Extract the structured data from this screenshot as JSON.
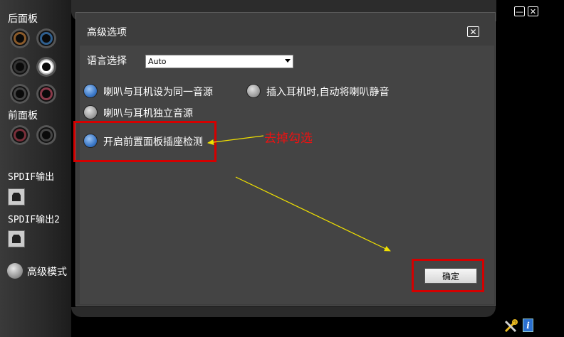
{
  "left_panel": {
    "rear_panel_label": "后面板",
    "front_panel_label": "前面板",
    "spdif_out_label": "SPDIF输出",
    "spdif_out2_label": "SPDIF输出2",
    "advanced_mode_label": "高级模式"
  },
  "dialog": {
    "title": "高级选项",
    "close_glyph": "✕",
    "language_label": "语言选择",
    "language_value": "Auto",
    "options": {
      "same_source": "喇叭与耳机设为同一音源",
      "auto_mute": "插入耳机时,自动将喇叭静音",
      "independent": "喇叭与耳机独立音源",
      "front_detect": "开启前置面板插座检测"
    },
    "option_states": {
      "same_source": true,
      "auto_mute": false,
      "independent": false,
      "front_detect": true
    },
    "ok_label": "确定"
  },
  "annotation": {
    "text": "去掉勾选",
    "color": "#e11111",
    "arrow_color": "#f0e000"
  },
  "window_controls": {
    "minimize_glyph": "—",
    "close_glyph": "✕"
  },
  "icons": [
    "tools-icon",
    "info-icon"
  ],
  "colors": {
    "radio_selected": "#3b78c8",
    "highlight_box": "#d40000",
    "dialog_bg": "#444444"
  }
}
